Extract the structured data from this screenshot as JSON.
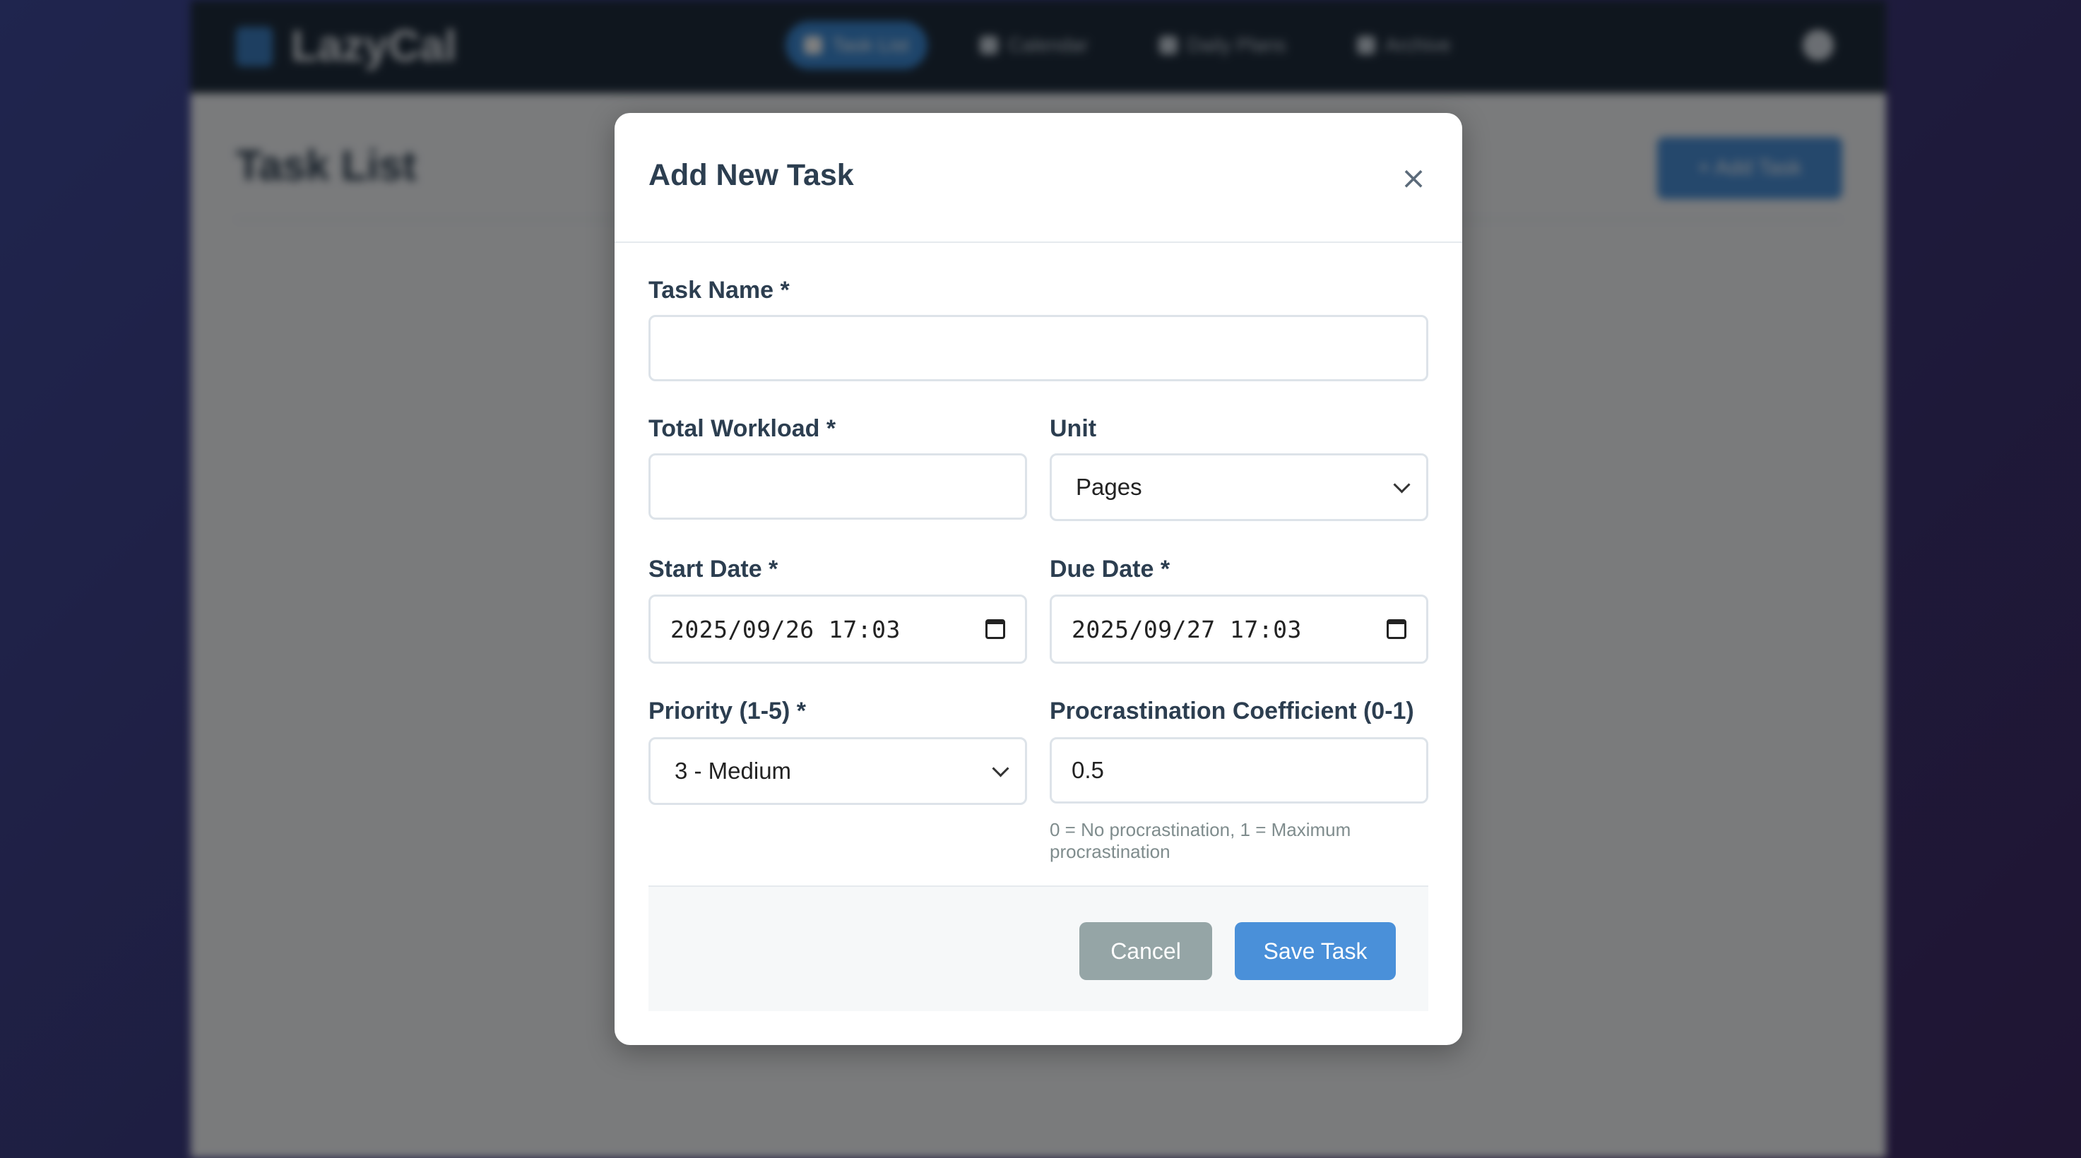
{
  "app": {
    "brand": "LazyCal",
    "nav": [
      {
        "label": "Task List",
        "active": true
      },
      {
        "label": "Calendar",
        "active": false
      },
      {
        "label": "Daily Plans",
        "active": false
      },
      {
        "label": "Archive",
        "active": false
      }
    ],
    "page_title": "Task List",
    "add_task_label": "+ Add Task",
    "colors": {
      "navbar": "#1f2d3d",
      "primary": "#4a90d9",
      "secondary": "#95a5a6"
    }
  },
  "modal": {
    "title": "Add New Task",
    "close_label": "×",
    "fields": {
      "task_name": {
        "label": "Task Name *",
        "value": ""
      },
      "total_workload": {
        "label": "Total Workload *",
        "value": ""
      },
      "unit": {
        "label": "Unit",
        "value": "Pages"
      },
      "start_date": {
        "label": "Start Date *",
        "value": "2025/09/26 17:03"
      },
      "due_date": {
        "label": "Due Date *",
        "value": "2025/09/27 17:03"
      },
      "priority": {
        "label": "Priority (1-5) *",
        "value": "3 - Medium"
      },
      "procrastination": {
        "label": "Procrastination Coefficient (0-1)",
        "value": "0.5",
        "help": "0 = No procrastination, 1 = Maximum procrastination"
      }
    },
    "buttons": {
      "cancel": "Cancel",
      "save": "Save Task"
    }
  }
}
